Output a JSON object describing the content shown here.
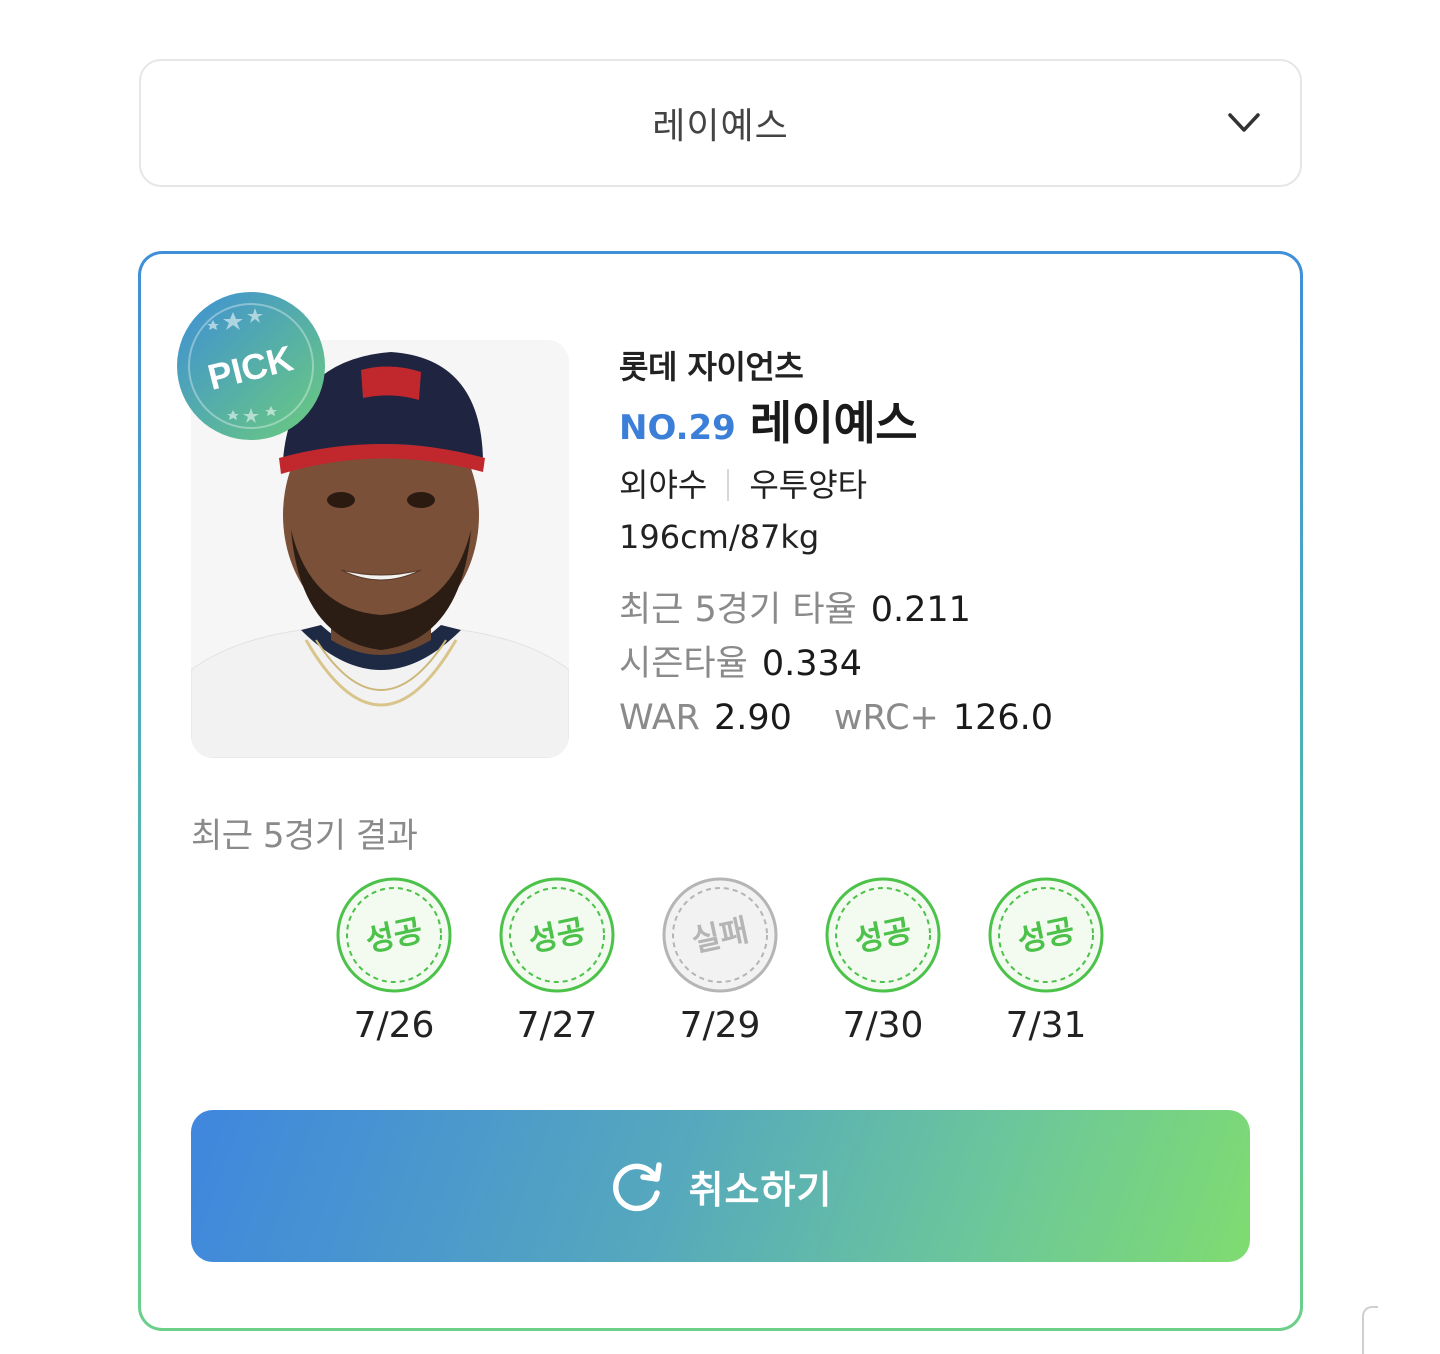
{
  "player_select": {
    "selected": "레이예스",
    "icon": "chevron-down-icon"
  },
  "player_card": {
    "badge": "PICK",
    "team": "롯데 자이언츠",
    "number": "NO.29",
    "name": "레이예스",
    "position": "외야수",
    "bats_throws": "우투양타",
    "body": "196cm/87kg",
    "stats": {
      "recent5_avg_label": "최근 5경기 타율",
      "recent5_avg": "0.211",
      "season_avg_label": "시즌타율",
      "season_avg": "0.334",
      "war_label": "WAR",
      "war": "2.90",
      "wrc_label": "wRC+",
      "wrc": "126.0"
    }
  },
  "recent_results": {
    "title": "최근 5경기 결과",
    "items": [
      {
        "result": "성공",
        "date": "7/26",
        "status": "success"
      },
      {
        "result": "성공",
        "date": "7/27",
        "status": "success"
      },
      {
        "result": "실패",
        "date": "7/29",
        "status": "fail"
      },
      {
        "result": "성공",
        "date": "7/30",
        "status": "success"
      },
      {
        "result": "성공",
        "date": "7/31",
        "status": "success"
      }
    ]
  },
  "cancel_button": {
    "label": "취소하기",
    "icon": "refresh-icon"
  },
  "colors": {
    "accent_blue": "#3b7fd8",
    "success_green": "#4cc24a",
    "fail_gray": "#b5b5b5",
    "gradient_start": "#3f86de",
    "gradient_end": "#7fdc70"
  }
}
